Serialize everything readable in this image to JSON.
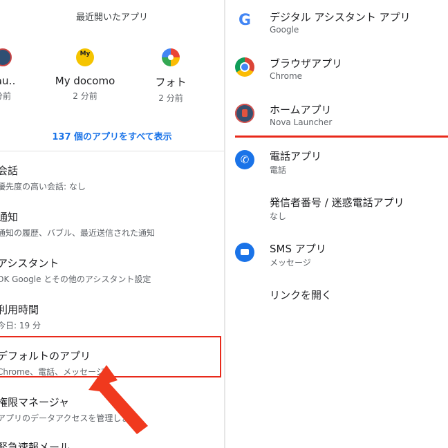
{
  "left": {
    "recent_header": "最近開いたアプリ",
    "recent_apps": [
      {
        "name": "Lau‥",
        "time": "分前",
        "icon": "nova-launcher-icon"
      },
      {
        "name": "My docomo",
        "time": "2 分前",
        "icon": "my-docomo-icon",
        "icon_text": "My"
      },
      {
        "name": "フォト",
        "time": "2 分前",
        "icon": "google-photos-icon"
      }
    ],
    "show_all": "137 個のアプリをすべて表示",
    "settings": [
      {
        "title": "会話",
        "subtitle": "優先度の高い会話: なし"
      },
      {
        "title": "通知",
        "subtitle": "通知の履歴、バブル、最近送信された通知"
      },
      {
        "title": "アシスタント",
        "subtitle": "OK Google とその他のアシスタント設定"
      },
      {
        "title": "利用時間",
        "subtitle": "今日: 19 分"
      },
      {
        "title": "デフォルトのアプリ",
        "subtitle": "Chrome、電話、メッセージ"
      },
      {
        "title": "権限マネージャ",
        "subtitle": "アプリのデータアクセスを管理します"
      },
      {
        "title": "緊急速報メール",
        "subtitle": ""
      }
    ],
    "highlight_color": "#e8291a"
  },
  "right": {
    "rows": [
      {
        "title": "デジタル アシスタント アプリ",
        "subtitle": "Google",
        "icon": "google-icon",
        "icon_text": "G"
      },
      {
        "title": "ブラウザアプリ",
        "subtitle": "Chrome",
        "icon": "chrome-icon"
      },
      {
        "title": "ホームアプリ",
        "subtitle": "Nova Launcher",
        "icon": "home-launcher-icon"
      },
      {
        "title": "電話アプリ",
        "subtitle": "電話",
        "icon": "phone-icon",
        "icon_text": "✆"
      },
      {
        "title": "発信者番号 / 迷惑電話アプリ",
        "subtitle": "なし",
        "icon": ""
      },
      {
        "title": "SMS アプリ",
        "subtitle": "メッセージ",
        "icon": "sms-icon"
      },
      {
        "title": "リンクを開く",
        "subtitle": "",
        "icon": ""
      }
    ],
    "accent_line_color": "#e8291a"
  }
}
